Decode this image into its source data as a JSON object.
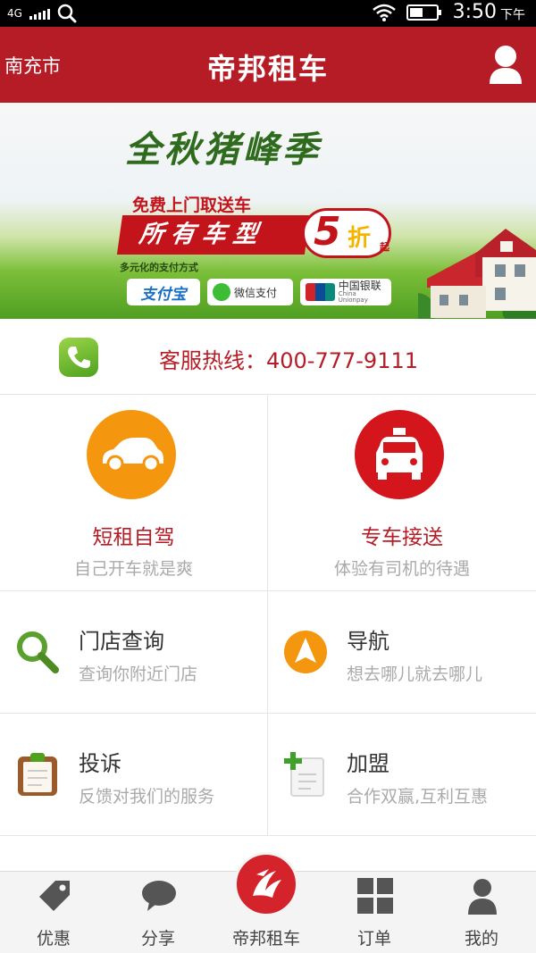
{
  "status_bar": {
    "network": "4G",
    "time": "3:50",
    "ampm": "下午"
  },
  "header": {
    "city": "南充市",
    "title": "帝邦租车"
  },
  "banner": {
    "slogan": "全秋猪峰季",
    "promo_top": "免费上门取送车",
    "promo_main": "所有车型",
    "discount_number": "5",
    "discount_text": "折",
    "discount_sub": "起",
    "payment_title": "多元化的支付方式",
    "payments": {
      "alipay": "支付宝",
      "wechat": "微信支付",
      "unionpay": "中国银联",
      "unionpay_en": "China Unionpay"
    },
    "carousel_active_index": 0,
    "carousel_count": 3
  },
  "hotline": {
    "label": "客服热线：400-777-9111"
  },
  "services": {
    "self_drive": {
      "title": "短租自驾",
      "subtitle": "自己开车就是爽"
    },
    "chauffeur": {
      "title": "专车接送",
      "subtitle": "体验有司机的待遇"
    }
  },
  "features": {
    "store_search": {
      "title": "门店查询",
      "subtitle": "查询你附近门店"
    },
    "navigation": {
      "title": "导航",
      "subtitle": "想去哪儿就去哪儿"
    },
    "complaint": {
      "title": "投诉",
      "subtitle": "反馈对我们的服务"
    },
    "franchise": {
      "title": "加盟",
      "subtitle": "合作双赢,互利互惠"
    }
  },
  "bottom_nav": {
    "deals": "优惠",
    "share": "分享",
    "home": "帝邦租车",
    "orders": "订单",
    "mine": "我的"
  },
  "colors": {
    "brand_red": "#b61c25",
    "orange": "#f5960f",
    "green": "#4ea21e"
  }
}
